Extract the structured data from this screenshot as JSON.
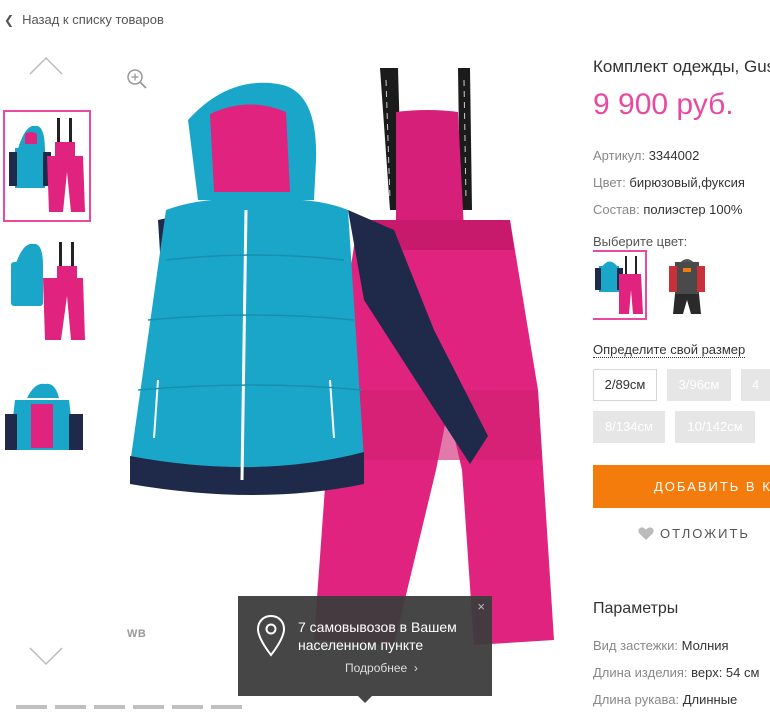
{
  "nav": {
    "back_label": "Назад к списку товаров"
  },
  "gallery": {
    "watermark": "WB",
    "thumbnails": [
      {
        "name": "jacket-and-overalls",
        "selected": true
      },
      {
        "name": "vest-and-overalls",
        "selected": false
      },
      {
        "name": "jacket-open",
        "selected": false
      }
    ],
    "page_dots": 6
  },
  "popup": {
    "message": "7 самовывозов в Вашем населенном пункте",
    "more_label": "Подробнее",
    "close_glyph": "×"
  },
  "product": {
    "title": "Комплект одежды, Gusti",
    "price": "9 900 руб.",
    "attributes": [
      {
        "key": "Артикул:",
        "value": "3344002"
      },
      {
        "key": "Цвет:",
        "value": "бирюзовый,фуксия"
      },
      {
        "key": "Состав:",
        "value": "полиэстер 100%"
      }
    ],
    "color_label": "Выберите цвет:",
    "size_link": "Определите свой размер",
    "sizes": [
      {
        "label": "2/89см",
        "available": true
      },
      {
        "label": "3/96см",
        "available": false
      },
      {
        "label": "4",
        "available": false
      },
      {
        "label": "8/134см",
        "available": false
      },
      {
        "label": "10/142см",
        "available": false
      }
    ],
    "add_button": "ДОБАВИТЬ В КОРЗИНУ",
    "postpone": "ОТЛОЖИТЬ",
    "params_title": "Параметры",
    "params": [
      {
        "key": "Вид застежки:",
        "value": "Молния"
      },
      {
        "key": "Длина изделия:",
        "value": "верх: 54 см"
      },
      {
        "key": "Длина рукава:",
        "value": "Длинные"
      }
    ]
  },
  "colors": {
    "accent": "#e94a9f",
    "button": "#f47c0c",
    "turquoise": "#1aa6c9",
    "navy": "#1f2a4a",
    "fuchsia": "#e0237e"
  }
}
